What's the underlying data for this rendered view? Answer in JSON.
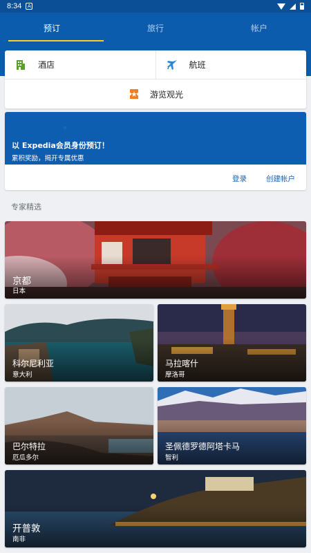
{
  "status_bar": {
    "time": "8:34",
    "badge": "A"
  },
  "tabs": [
    {
      "label": "预订",
      "active": true
    },
    {
      "label": "旅行",
      "active": false
    },
    {
      "label": "帐户",
      "active": false
    }
  ],
  "booking": {
    "hotel": {
      "label": "酒店",
      "icon": "hotel-icon"
    },
    "flight": {
      "label": "航班",
      "icon": "airplane-icon"
    },
    "activities": {
      "label": "游览观光",
      "icon": "ticket-icon"
    }
  },
  "promo": {
    "title": "以 Expedia会员身份预订！",
    "subtitle": "累积奖励，揭开专属优惠",
    "login": "登录",
    "create_account": "创建帐户"
  },
  "section": {
    "title": "专家精选"
  },
  "destinations": [
    {
      "name": "京都",
      "country": "日本"
    },
    {
      "name": "科尔尼利亚",
      "country": "意大利"
    },
    {
      "name": "马拉喀什",
      "country": "摩洛哥"
    },
    {
      "name": "巴尔特拉",
      "country": "厄瓜多尔"
    },
    {
      "name": "圣佩德罗德阿塔卡马",
      "country": "智利"
    },
    {
      "name": "开普敦",
      "country": "南非"
    }
  ],
  "colors": {
    "header_blue": "#0b5cad",
    "tab_indicator": "#ffd21f",
    "link_blue": "#1a65b8",
    "hotel_green": "#5aa02c",
    "flight_blue": "#2a86d1",
    "tour_orange": "#f17e22"
  }
}
